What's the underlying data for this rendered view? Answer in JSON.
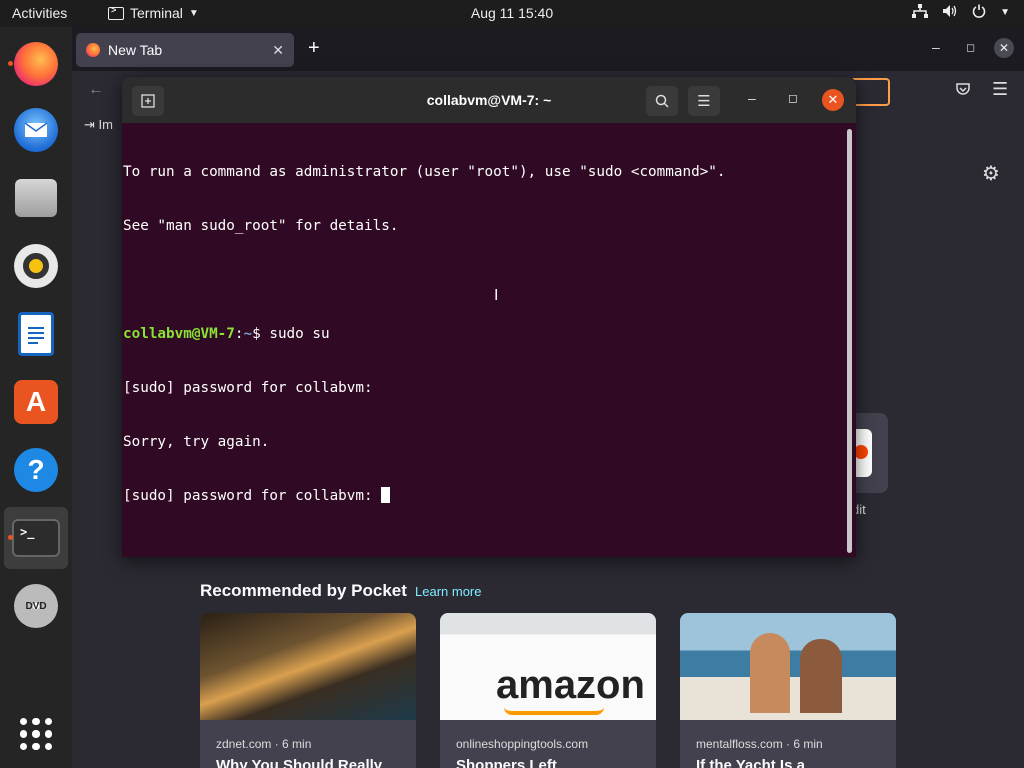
{
  "topbar": {
    "activities": "Activities",
    "app_name": "Terminal",
    "clock": "Aug 11  15:40"
  },
  "firefox": {
    "tab_title": "New Tab",
    "bookmark_label": "Im",
    "shortcut_label": "dit",
    "pocket_title": "Recommended by Pocket",
    "pocket_learn_more": "Learn more",
    "cards": [
      {
        "source": "zdnet.com · 6 min",
        "title": "Why You Should Really"
      },
      {
        "source": "onlineshoppingtools.com",
        "title": "Shoppers Left"
      },
      {
        "source": "mentalfloss.com · 6 min",
        "title": "If the Yacht Is a"
      }
    ],
    "card2_logo_text": "amazon"
  },
  "terminal": {
    "title": "collabvm@VM-7: ~",
    "lines": {
      "l1": "To run a command as administrator (user \"root\"), use \"sudo <command>\".",
      "l2": "See \"man sudo_root\" for details.",
      "prompt_user": "collabvm@VM-7",
      "prompt_sep": ":",
      "prompt_path": "~",
      "prompt_cmd": "$ sudo su",
      "l4": "[sudo] password for collabvm:",
      "l5": "Sorry, try again.",
      "l6": "[sudo] password for collabvm: "
    }
  },
  "dock": {
    "terminal_glyph": ">_",
    "dvd_label": "DVD"
  }
}
